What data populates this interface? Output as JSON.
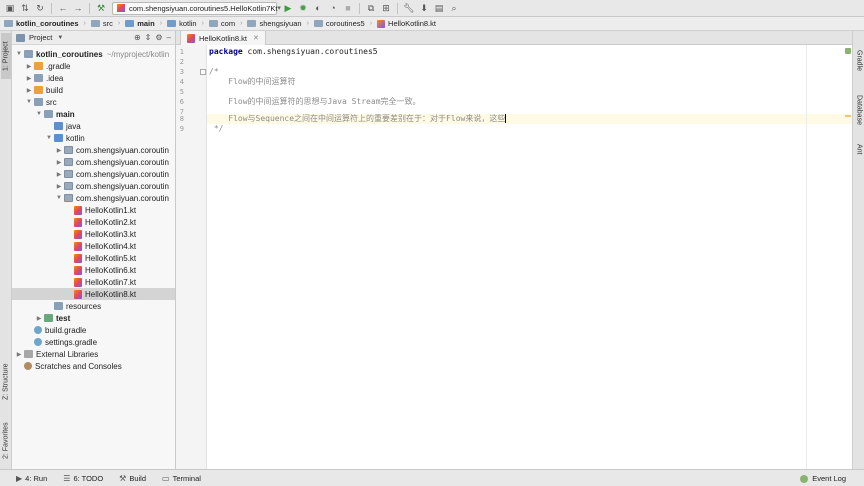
{
  "toolbar": {
    "run_config": "com.shengsiyuan.coroutines5.HelloKotlin7Kt",
    "icons": [
      "save-icon",
      "sync-icon",
      "refresh-icon",
      "back-icon",
      "forward-icon",
      "build-icon",
      "run-icon",
      "debug-icon",
      "coverage-icon",
      "profile-icon",
      "stop-icon",
      "attach-icon",
      "wrench-icon",
      "structure-icon",
      "project-structure-icon",
      "search-icon"
    ]
  },
  "breadcrumb": [
    "kotlin_coroutines",
    "src",
    "main",
    "kotlin",
    "com",
    "shengsiyuan",
    "coroutines5",
    "HelloKotlin8.kt"
  ],
  "left_tabs": {
    "project": "1: Project",
    "structure": "Z: Structure",
    "favorites": "2: Favorites"
  },
  "right_tabs": {
    "gradle": "Gradle",
    "database": "Database",
    "ant": "Ant"
  },
  "project_panel": {
    "title": "Project",
    "root_name": "kotlin_coroutines",
    "root_path": "~/myproject/kotlin",
    "items": [
      {
        "label": ".gradle"
      },
      {
        "label": ".idea"
      },
      {
        "label": "build"
      },
      {
        "label": "src"
      },
      {
        "label": "main"
      },
      {
        "label": "java"
      },
      {
        "label": "kotlin"
      },
      {
        "label": "com.shengsiyuan.coroutin"
      },
      {
        "label": "com.shengsiyuan.coroutin"
      },
      {
        "label": "com.shengsiyuan.coroutin"
      },
      {
        "label": "com.shengsiyuan.coroutin"
      },
      {
        "label": "com.shengsiyuan.coroutin"
      },
      {
        "label": "HelloKotlin1.kt"
      },
      {
        "label": "HelloKotlin2.kt"
      },
      {
        "label": "HelloKotlin3.kt"
      },
      {
        "label": "HelloKotlin4.kt"
      },
      {
        "label": "HelloKotlin5.kt"
      },
      {
        "label": "HelloKotlin6.kt"
      },
      {
        "label": "HelloKotlin7.kt"
      },
      {
        "label": "HelloKotlin8.kt"
      },
      {
        "label": "resources"
      },
      {
        "label": "test"
      },
      {
        "label": "build.gradle"
      },
      {
        "label": "settings.gradle"
      },
      {
        "label": "External Libraries"
      },
      {
        "label": "Scratches and Consoles"
      }
    ]
  },
  "editor": {
    "tab_label": "HelloKotlin8.kt",
    "line_numbers": [
      "1",
      "2",
      "3",
      "4",
      "5",
      "6",
      "7",
      "8",
      "9"
    ],
    "lines": {
      "l1_kw": "package",
      "l1_rest": " com.shengsiyuan.coroutines5",
      "l3": "/*",
      "l4": "    Flow的中间运算符",
      "l6": "    Flow的中间运算符的思想与Java Stream完全一致。",
      "l8": "    Flow与Sequence之间在中间运算符上的重要差别在于：对于Flow来说，这些",
      "l9": " */"
    }
  },
  "statusbar": {
    "run": "4: Run",
    "todo": "6: TODO",
    "build": "Build",
    "terminal": "Terminal",
    "event_log": "Event Log"
  }
}
